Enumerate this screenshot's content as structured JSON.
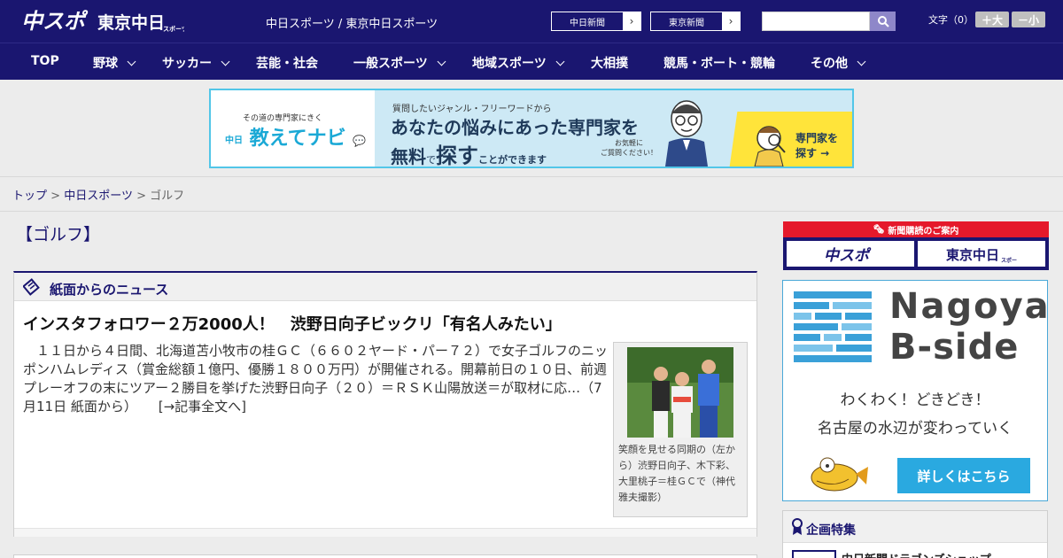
{
  "header": {
    "logo_chuspo": "中スポ",
    "logo_tokyo": "東京中日",
    "logo_tokyo_sub": "スポーツ",
    "site_links": "中日スポーツ / 東京中日スポーツ",
    "paper_buttons": [
      {
        "label": "中日新聞"
      },
      {
        "label": "東京新聞"
      }
    ],
    "search_placeholder": "",
    "font_size_label": "文字（0）",
    "font_larger": "＋大",
    "font_smaller": "－小"
  },
  "nav": {
    "items": [
      {
        "label": "TOP",
        "dropdown": false
      },
      {
        "label": "野球",
        "dropdown": true
      },
      {
        "label": "サッカー",
        "dropdown": true
      },
      {
        "label": "芸能・社会",
        "dropdown": false
      },
      {
        "label": "一般スポーツ",
        "dropdown": true
      },
      {
        "label": "地域スポーツ",
        "dropdown": true
      },
      {
        "label": "大相撲",
        "dropdown": false
      },
      {
        "label": "競馬・ボート・競輪",
        "dropdown": false
      },
      {
        "label": "その他",
        "dropdown": true
      }
    ]
  },
  "banner_ad": {
    "tagline": "その道の専門家にきく",
    "brand": "教えてナビ",
    "brand_prefix": "中日",
    "question": "質問したいジャンル・フリーワードから",
    "headline1": "あなたの悩みにあった専門家を",
    "headline2_a": "無料",
    "headline2_b": "で",
    "headline2_c": "探す",
    "headline2_d": "ことができます",
    "small_note1": "お気軽に",
    "small_note2": "ご質問ください！",
    "cta1": "専門家を",
    "cta2": "探す →"
  },
  "breadcrumb": {
    "top": "トップ",
    "chunichi": "中日スポーツ",
    "current": "ゴルフ",
    "separator": ">"
  },
  "page_title": "【ゴルフ】",
  "news": {
    "section_label": "紙面からのニュース",
    "headline": "インスタフォロワー２万2000人！　渋野日向子ビックリ「有名人みたい」",
    "body": "　１１日から４日間、北海道苫小牧市の桂ＧＣ（６６０２ヤード・パー７２）で女子ゴルフのニッポンハムレディス（賞金総額１億円、優勝１８００万円）が開催される。開幕前日の１０日、前週プレーオフの末にツアー２勝目を挙げた渋野日向子（２０）＝ＲＳＫ山陽放送＝が取材に応…（7月11日 紙面から）",
    "more_link": "[→記事全文へ]",
    "photo_caption": "笑顔を見せる同期の（左から）渋野日向子、木下彩、大里桃子＝桂ＧＣで（神代雅夫撮影）"
  },
  "sidebar": {
    "subscription_label": "新聞購読のご案内",
    "subscription_buttons": [
      {
        "label": "中スポ"
      },
      {
        "label": "東京中日"
      }
    ],
    "nagoya": {
      "title1": "Nagoya",
      "title2": "B-side",
      "line1": "わくわく！どきどき！",
      "line2": "名古屋の水辺が変わっていく",
      "button": "詳しくはこちら"
    },
    "feature": {
      "label": "企画特集",
      "item": "中日新聞ドラゴンズショップ"
    }
  },
  "colors": {
    "brand_navy": "#1a1670",
    "accent_red": "#e5192b",
    "link_blue": "#2aa9e0"
  }
}
